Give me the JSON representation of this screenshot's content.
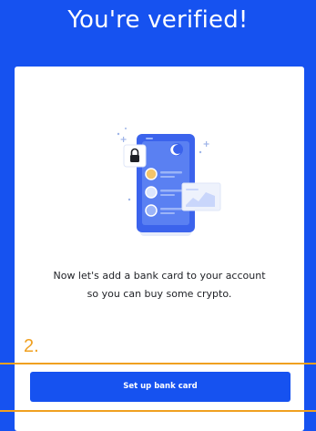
{
  "header": {
    "title": "You're verified!"
  },
  "card": {
    "message_line1": "Now let's add a bank card to your account",
    "message_line2": "so you can buy some crypto.",
    "illustration_icon": "phone-with-lock-and-moon-illustration"
  },
  "annotation": {
    "step_label": "2."
  },
  "actions": {
    "cta_label": "Set up bank card"
  },
  "colors": {
    "brand_blue": "#1652f0",
    "annotation_orange": "#f0a020",
    "text_dark": "#1e2025"
  }
}
